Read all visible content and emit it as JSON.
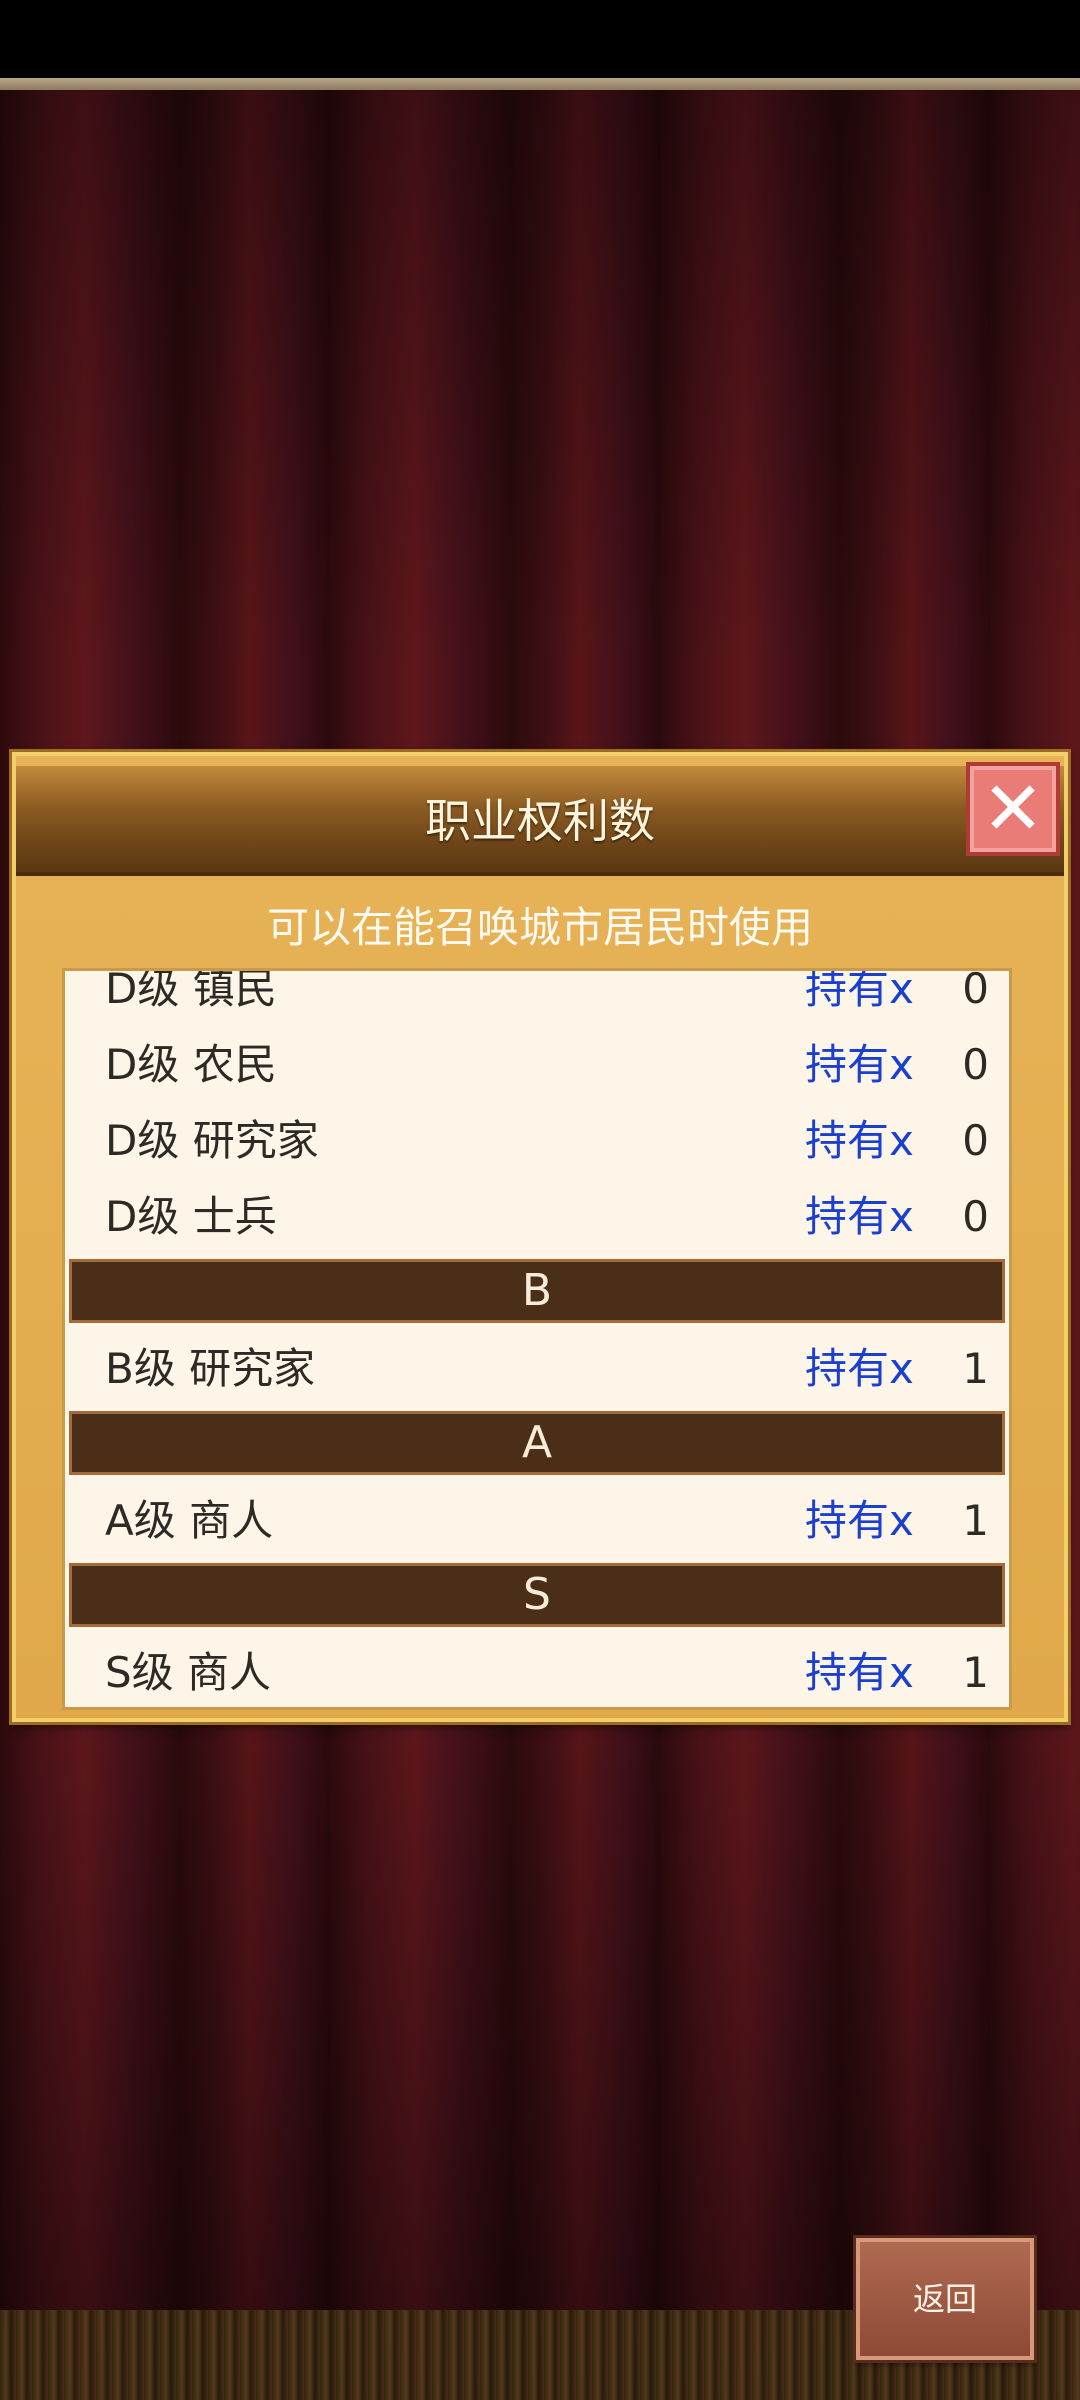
{
  "dialog": {
    "title": "职业权利数",
    "subtitle": "可以在能召唤城市居民时使用",
    "close_icon": "close-icon"
  },
  "list": {
    "rows": [
      {
        "name": "D级 镇民",
        "hold": "持有x",
        "count": "0"
      },
      {
        "name": "D级 农民",
        "hold": "持有x",
        "count": "0"
      },
      {
        "name": "D级 研究家",
        "hold": "持有x",
        "count": "0"
      },
      {
        "name": "D级 士兵",
        "hold": "持有x",
        "count": "0"
      }
    ],
    "section_b": "B",
    "row_b1": {
      "name": "B级 研究家",
      "hold": "持有x",
      "count": "1"
    },
    "section_a": "A",
    "row_a1": {
      "name": "A级 商人",
      "hold": "持有x",
      "count": "1"
    },
    "section_s": "S",
    "row_s1": {
      "name": "S级 商人",
      "hold": "持有x",
      "count": "1"
    }
  },
  "footer": {
    "back_label": "返回"
  },
  "colors": {
    "hold_text": "#1b3fd0",
    "section_bg": "#4b2e18",
    "panel_bg": "#fdf6e8",
    "dialog_bg": "#e0a849"
  }
}
